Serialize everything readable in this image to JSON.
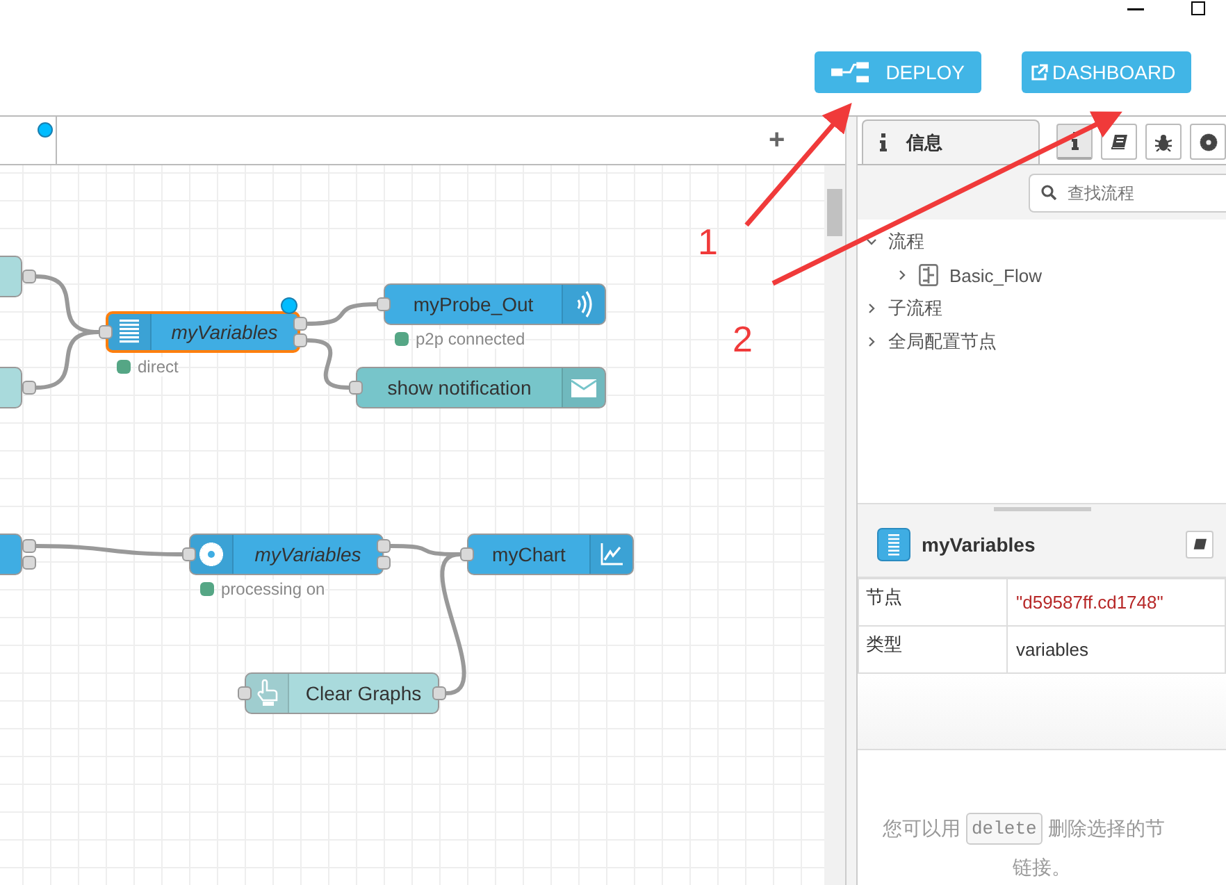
{
  "toolbar": {
    "buttons": [
      {
        "kind": "deploy",
        "label": "DEPLOY"
      },
      {
        "kind": "dashboard",
        "label": "DASHBOARD"
      }
    ]
  },
  "workspace": {
    "tab": {
      "changed": true
    },
    "add_tab": "+",
    "nodes": [
      {
        "kind": "stub",
        "color": "#a9dadc"
      },
      {
        "kind": "stub",
        "color": "#a9dadc"
      },
      {
        "kind": "variables",
        "label": "myVariables",
        "italic": true,
        "selected": true,
        "changed": true,
        "color": "#3fade3",
        "status": {
          "text": "direct",
          "color": "#55a685"
        }
      },
      {
        "kind": "probe",
        "label": "myProbe_Out",
        "italic": false,
        "selected": false,
        "changed": false,
        "color": "#3fade3",
        "status": {
          "text": "p2p connected",
          "color": "#55a685"
        }
      },
      {
        "kind": "notification",
        "label": "show notification",
        "italic": false,
        "selected": false,
        "changed": false,
        "color": "#77c5ca"
      },
      {
        "kind": "stub",
        "color": "#3fade3"
      },
      {
        "kind": "gear",
        "label": "myVariables",
        "italic": true,
        "selected": false,
        "changed": false,
        "color": "#3fade3",
        "status": {
          "text": "processing on",
          "color": "#55a685"
        }
      },
      {
        "kind": "chart",
        "label": "myChart",
        "italic": false,
        "selected": false,
        "changed": false,
        "color": "#3fade3"
      },
      {
        "kind": "button",
        "label": "Clear Graphs",
        "italic": false,
        "selected": false,
        "changed": false,
        "color": "#a9dadc"
      }
    ]
  },
  "sidebar": {
    "tab": {
      "label": "信息",
      "selected": true
    },
    "tool_buttons": [
      {
        "kind": "info",
        "selected": true
      },
      {
        "kind": "help",
        "selected": false
      },
      {
        "kind": "debug",
        "selected": false
      },
      {
        "kind": "config",
        "selected": false
      }
    ],
    "search": {
      "placeholder": "查找流程"
    },
    "tree": [
      {
        "label": "流程",
        "expanded": true,
        "children": [
          {
            "label": "Basic_Flow"
          }
        ]
      },
      {
        "label": "子流程",
        "expanded": false
      },
      {
        "label": "全局配置节点",
        "expanded": false
      }
    ],
    "info": {
      "title": "myVariables",
      "properties": [
        {
          "key": "节点",
          "value": "\"d59587ff.cd1748\"",
          "kind": "string"
        },
        {
          "key": "类型",
          "value": "variables",
          "kind": "text"
        }
      ]
    },
    "hint": {
      "before": "您可以用",
      "key": "delete",
      "after": "删除选择的节",
      "line2": "链接。"
    }
  },
  "annotations": [
    {
      "label": "1"
    },
    {
      "label": "2"
    }
  ]
}
